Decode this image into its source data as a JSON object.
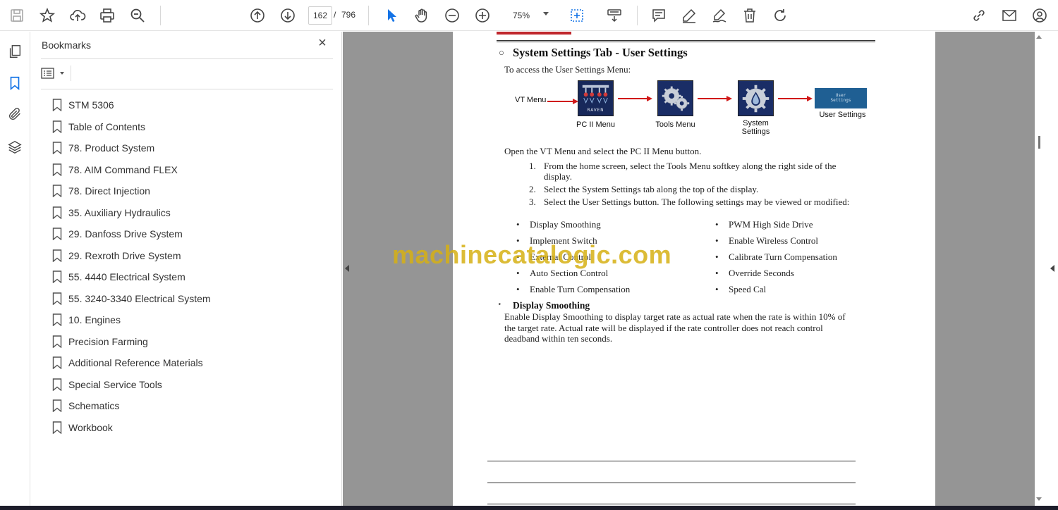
{
  "toolbar": {
    "page_current": "162",
    "page_separator": "/",
    "page_total": "796",
    "zoom": "75%"
  },
  "bookmarks": {
    "title": "Bookmarks",
    "close": "×",
    "items": [
      {
        "label": "STM 5306"
      },
      {
        "label": "Table of Contents"
      },
      {
        "label": "78. Product System"
      },
      {
        "label": "78. AIM Command FLEX"
      },
      {
        "label": "78. Direct Injection"
      },
      {
        "label": "35. Auxiliary Hydraulics"
      },
      {
        "label": "29. Danfoss Drive System"
      },
      {
        "label": "29. Rexroth Drive System"
      },
      {
        "label": "55. 4440 Electrical System"
      },
      {
        "label": "55. 3240-3340 Electrical System"
      },
      {
        "label": "10. Engines"
      },
      {
        "label": "Precision Farming"
      },
      {
        "label": "Additional Reference Materials"
      },
      {
        "label": "Special Service Tools"
      },
      {
        "label": "Schematics"
      },
      {
        "label": "Workbook"
      }
    ]
  },
  "document": {
    "heading_bullet": "○",
    "heading": "System Settings Tab - User Settings",
    "intro": "To access the User Settings Menu:",
    "flow": {
      "vt_menu": "VT Menu",
      "raven": "RAVEN",
      "pc2_menu": "PC II Menu",
      "tools_menu": "Tools Menu",
      "system_settings_1": "System",
      "system_settings_2": "Settings",
      "us_box_1": "User",
      "us_box_2": "Settings",
      "user_settings": "User Settings"
    },
    "open_text": "Open the VT Menu and select the PC II Menu button.",
    "steps": [
      {
        "num": "1.",
        "text": "From the home screen, select the Tools Menu softkey along the right side of the display."
      },
      {
        "num": "2.",
        "text": "Select the System Settings tab along the top of the display."
      },
      {
        "num": "3.",
        "text": "Select the User Settings button. The following settings may be viewed or modified:"
      }
    ],
    "settings_left": [
      "Display Smoothing",
      "Implement Switch",
      "External Control",
      "Auto Section Control",
      "Enable Turn Compensation"
    ],
    "settings_right": [
      "PWM High Side Drive",
      "Enable Wireless Control",
      "Calibrate Turn Compensation",
      "Override Seconds",
      "Speed Cal"
    ],
    "sub_bullet": "‣",
    "sub_heading": "Display Smoothing",
    "description": "Enable Display Smoothing to display target rate as actual rate when the rate is within 10% of the target rate. Actual rate will be displayed if the rate controller does not reach control deadband within ten seconds."
  },
  "watermark": "machinecatalogic.com"
}
